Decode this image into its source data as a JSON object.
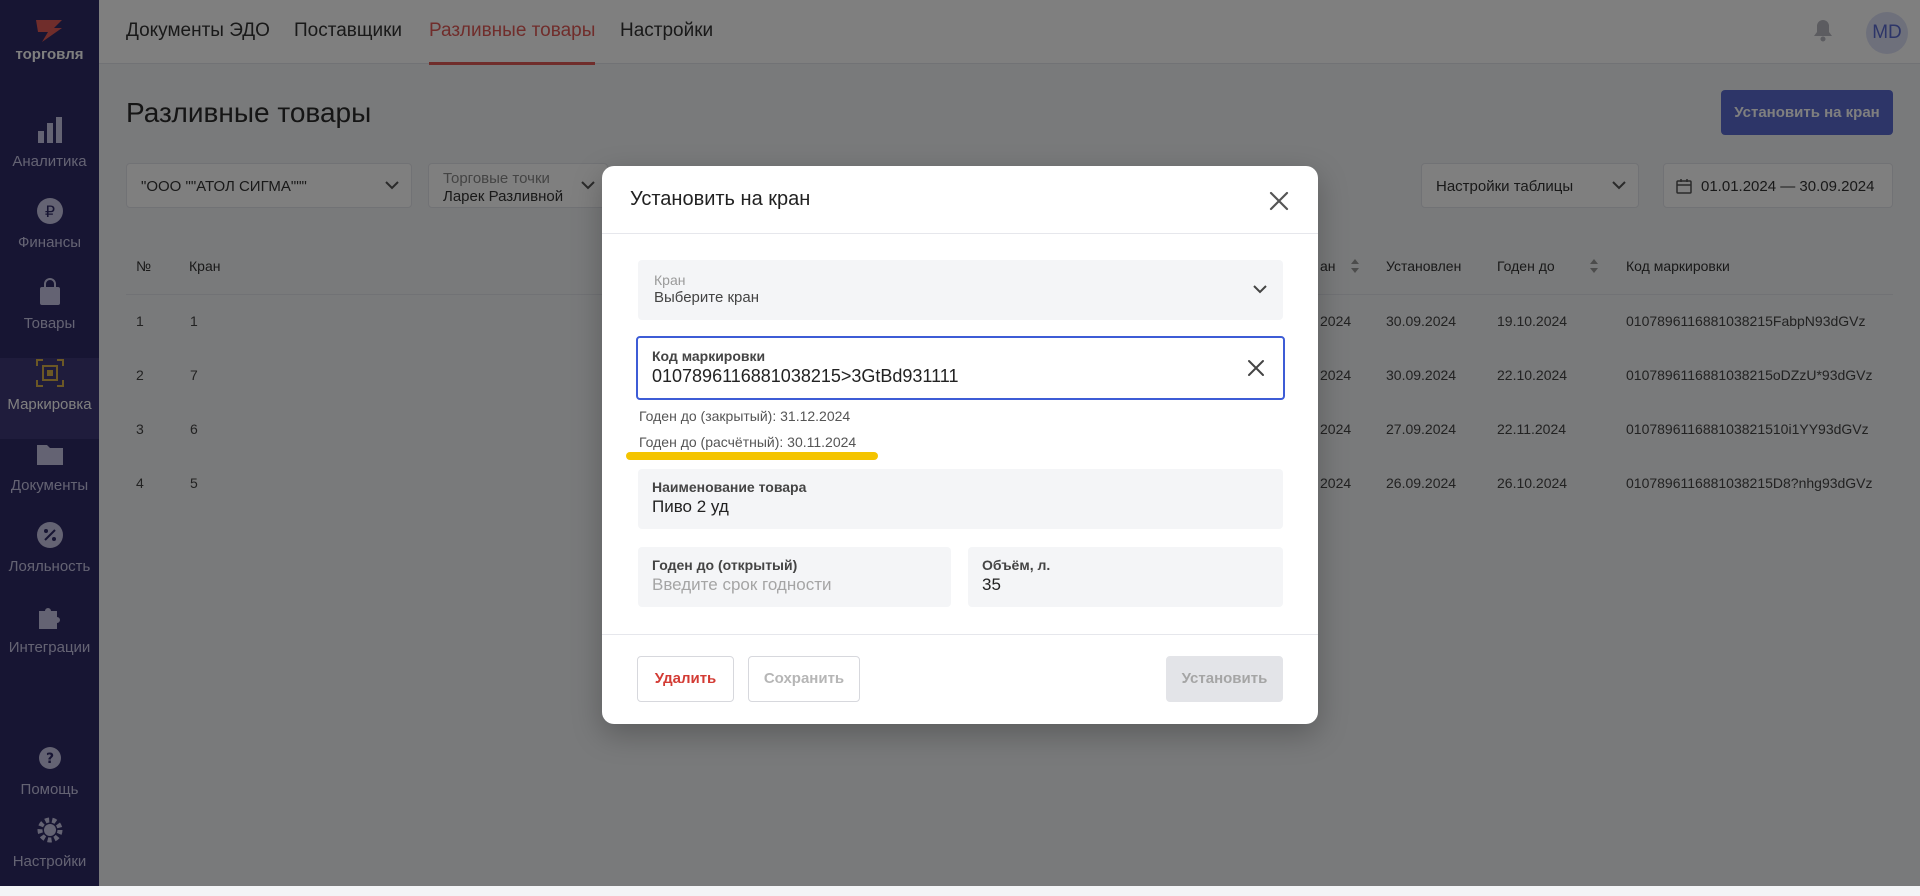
{
  "sidebar": {
    "logo_text": "торговля",
    "items": [
      {
        "label": "Аналитика",
        "icon": "analytics-icon"
      },
      {
        "label": "Финансы",
        "icon": "ruble-icon"
      },
      {
        "label": "Товары",
        "icon": "shopping-bag-icon"
      },
      {
        "label": "Маркировка",
        "icon": "barcode-icon",
        "active": true
      },
      {
        "label": "Документы",
        "icon": "folder-icon"
      },
      {
        "label": "Лояльность",
        "icon": "discount-icon"
      },
      {
        "label": "Интеграции",
        "icon": "puzzle-icon"
      },
      {
        "label": "Помощь",
        "icon": "help-icon"
      },
      {
        "label": "Настройки",
        "icon": "gear-icon"
      }
    ]
  },
  "topnav": {
    "tabs": [
      {
        "label": "Документы ЭДО"
      },
      {
        "label": "Поставщики"
      },
      {
        "label": "Разливные товары",
        "active": true
      },
      {
        "label": "Настройки"
      }
    ],
    "avatar_initials": "MD"
  },
  "page": {
    "title": "Разливные товары",
    "install_button": "Установить на кран",
    "filters": {
      "org": "\"ООО \"\"АТОЛ СИГМА\"\"\"",
      "outlets_label": "Торговые точки",
      "outlets_value": "Ларек Разливной",
      "table_settings": "Настройки таблицы",
      "date_range": "01.01.2024 — 30.09.2024"
    }
  },
  "table": {
    "headers": {
      "num": "№",
      "tap": "Кран",
      "col_partial": "ан",
      "installed": "Установлен",
      "expiry": "Годен до",
      "marking": "Код маркировки"
    },
    "rows": [
      {
        "num": "1",
        "tap": "1",
        "date_partial": "2024",
        "installed": "30.09.2024",
        "expiry": "19.10.2024",
        "code": "0107896116881038215FabpN93dGVz"
      },
      {
        "num": "2",
        "tap": "7",
        "date_partial": "2024",
        "installed": "30.09.2024",
        "expiry": "22.10.2024",
        "code": "0107896116881038215oDZzU*93dGVz"
      },
      {
        "num": "3",
        "tap": "6",
        "date_partial": "2024",
        "installed": "27.09.2024",
        "expiry": "22.11.2024",
        "code": "010789611688103821510i1YY93dGVz"
      },
      {
        "num": "4",
        "tap": "5",
        "date_partial": "2024",
        "installed": "26.09.2024",
        "expiry": "26.10.2024",
        "code": "0107896116881038215D8?nhg93dGVz"
      }
    ]
  },
  "modal": {
    "title": "Установить на кран",
    "tap_field": {
      "label": "Кран",
      "placeholder": "Выберите кран"
    },
    "marking_field": {
      "label": "Код маркировки",
      "value": "0107896116881038215>3GtBd931111"
    },
    "hint_closed": "Годен до (закрытый): 31.12.2024",
    "hint_calc": "Годен до (расчётный): 30.11.2024",
    "product_field": {
      "label": "Наименование товара",
      "value": "Пиво 2 уд"
    },
    "open_expiry_field": {
      "label": "Годен до (открытый)",
      "placeholder": "Введите срок годности"
    },
    "volume_field": {
      "label": "Объём, л.",
      "value": "35"
    },
    "buttons": {
      "delete": "Удалить",
      "save": "Сохранить",
      "install": "Установить"
    }
  },
  "colors": {
    "accent": "#e05a57",
    "primary": "#5a6bd1",
    "focus_border": "#3d5cd6",
    "highlight": "#f4c400",
    "sidebar_bg": "#2f2a66"
  }
}
